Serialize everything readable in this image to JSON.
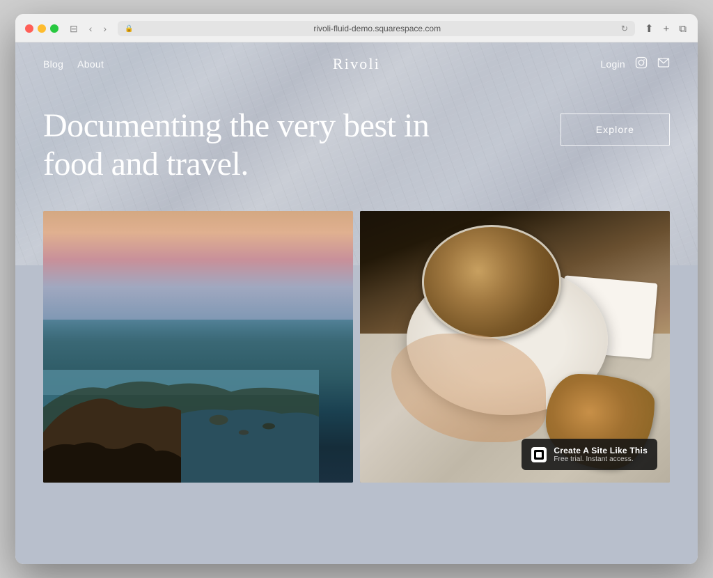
{
  "browser": {
    "url": "rivoli-fluid-demo.squarespace.com",
    "reload_icon": "↻",
    "back_icon": "‹",
    "forward_icon": "›",
    "sidebar_icon": "⊟",
    "share_icon": "⬆",
    "new_tab_icon": "+",
    "duplicate_icon": "⧉"
  },
  "nav": {
    "blog_label": "Blog",
    "about_label": "About",
    "site_title": "Rivoli",
    "login_label": "Login"
  },
  "hero": {
    "headline": "Documenting the very best in food and travel.",
    "explore_button": "Explore"
  },
  "images": {
    "coastal_alt": "Coastal landscape with cliffs and ocean at sunset",
    "food_alt": "Coffee cup and croissant on marble surface"
  },
  "badge": {
    "title": "Create A Site Like This",
    "subtitle": "Free trial. Instant access.",
    "logo_alt": "squarespace-logo"
  }
}
